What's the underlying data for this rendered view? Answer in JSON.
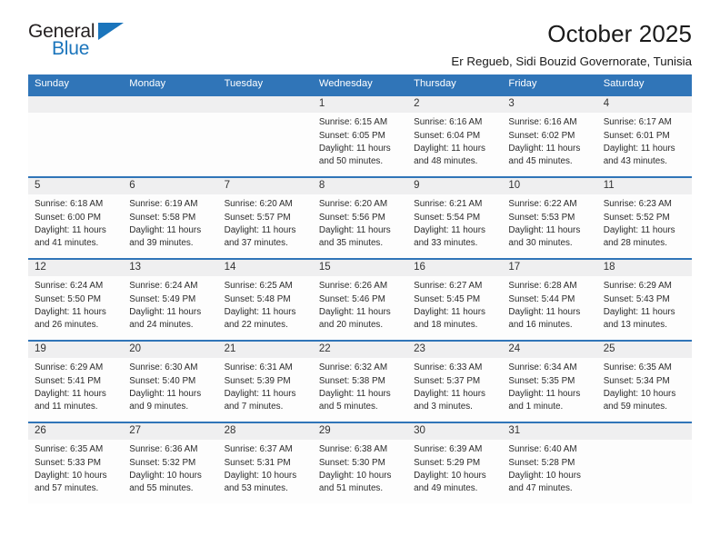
{
  "brand": {
    "name_part1": "General",
    "name_part2": "Blue",
    "accent_color": "#1b75bc",
    "triangle_icon": "triangle-icon"
  },
  "header": {
    "title": "October 2025",
    "subtitle": "Er Regueb, Sidi Bouzid Governorate, Tunisia"
  },
  "calendar": {
    "header_color": "#3075b8",
    "date_band_color": "#efeff0",
    "weekdays": [
      "Sunday",
      "Monday",
      "Tuesday",
      "Wednesday",
      "Thursday",
      "Friday",
      "Saturday"
    ],
    "weeks": [
      [
        {
          "day": "",
          "sunrise": "",
          "sunset": "",
          "daylight_line1": "",
          "daylight_line2": ""
        },
        {
          "day": "",
          "sunrise": "",
          "sunset": "",
          "daylight_line1": "",
          "daylight_line2": ""
        },
        {
          "day": "",
          "sunrise": "",
          "sunset": "",
          "daylight_line1": "",
          "daylight_line2": ""
        },
        {
          "day": "1",
          "sunrise": "Sunrise: 6:15 AM",
          "sunset": "Sunset: 6:05 PM",
          "daylight_line1": "Daylight: 11 hours",
          "daylight_line2": "and 50 minutes."
        },
        {
          "day": "2",
          "sunrise": "Sunrise: 6:16 AM",
          "sunset": "Sunset: 6:04 PM",
          "daylight_line1": "Daylight: 11 hours",
          "daylight_line2": "and 48 minutes."
        },
        {
          "day": "3",
          "sunrise": "Sunrise: 6:16 AM",
          "sunset": "Sunset: 6:02 PM",
          "daylight_line1": "Daylight: 11 hours",
          "daylight_line2": "and 45 minutes."
        },
        {
          "day": "4",
          "sunrise": "Sunrise: 6:17 AM",
          "sunset": "Sunset: 6:01 PM",
          "daylight_line1": "Daylight: 11 hours",
          "daylight_line2": "and 43 minutes."
        }
      ],
      [
        {
          "day": "5",
          "sunrise": "Sunrise: 6:18 AM",
          "sunset": "Sunset: 6:00 PM",
          "daylight_line1": "Daylight: 11 hours",
          "daylight_line2": "and 41 minutes."
        },
        {
          "day": "6",
          "sunrise": "Sunrise: 6:19 AM",
          "sunset": "Sunset: 5:58 PM",
          "daylight_line1": "Daylight: 11 hours",
          "daylight_line2": "and 39 minutes."
        },
        {
          "day": "7",
          "sunrise": "Sunrise: 6:20 AM",
          "sunset": "Sunset: 5:57 PM",
          "daylight_line1": "Daylight: 11 hours",
          "daylight_line2": "and 37 minutes."
        },
        {
          "day": "8",
          "sunrise": "Sunrise: 6:20 AM",
          "sunset": "Sunset: 5:56 PM",
          "daylight_line1": "Daylight: 11 hours",
          "daylight_line2": "and 35 minutes."
        },
        {
          "day": "9",
          "sunrise": "Sunrise: 6:21 AM",
          "sunset": "Sunset: 5:54 PM",
          "daylight_line1": "Daylight: 11 hours",
          "daylight_line2": "and 33 minutes."
        },
        {
          "day": "10",
          "sunrise": "Sunrise: 6:22 AM",
          "sunset": "Sunset: 5:53 PM",
          "daylight_line1": "Daylight: 11 hours",
          "daylight_line2": "and 30 minutes."
        },
        {
          "day": "11",
          "sunrise": "Sunrise: 6:23 AM",
          "sunset": "Sunset: 5:52 PM",
          "daylight_line1": "Daylight: 11 hours",
          "daylight_line2": "and 28 minutes."
        }
      ],
      [
        {
          "day": "12",
          "sunrise": "Sunrise: 6:24 AM",
          "sunset": "Sunset: 5:50 PM",
          "daylight_line1": "Daylight: 11 hours",
          "daylight_line2": "and 26 minutes."
        },
        {
          "day": "13",
          "sunrise": "Sunrise: 6:24 AM",
          "sunset": "Sunset: 5:49 PM",
          "daylight_line1": "Daylight: 11 hours",
          "daylight_line2": "and 24 minutes."
        },
        {
          "day": "14",
          "sunrise": "Sunrise: 6:25 AM",
          "sunset": "Sunset: 5:48 PM",
          "daylight_line1": "Daylight: 11 hours",
          "daylight_line2": "and 22 minutes."
        },
        {
          "day": "15",
          "sunrise": "Sunrise: 6:26 AM",
          "sunset": "Sunset: 5:46 PM",
          "daylight_line1": "Daylight: 11 hours",
          "daylight_line2": "and 20 minutes."
        },
        {
          "day": "16",
          "sunrise": "Sunrise: 6:27 AM",
          "sunset": "Sunset: 5:45 PM",
          "daylight_line1": "Daylight: 11 hours",
          "daylight_line2": "and 18 minutes."
        },
        {
          "day": "17",
          "sunrise": "Sunrise: 6:28 AM",
          "sunset": "Sunset: 5:44 PM",
          "daylight_line1": "Daylight: 11 hours",
          "daylight_line2": "and 16 minutes."
        },
        {
          "day": "18",
          "sunrise": "Sunrise: 6:29 AM",
          "sunset": "Sunset: 5:43 PM",
          "daylight_line1": "Daylight: 11 hours",
          "daylight_line2": "and 13 minutes."
        }
      ],
      [
        {
          "day": "19",
          "sunrise": "Sunrise: 6:29 AM",
          "sunset": "Sunset: 5:41 PM",
          "daylight_line1": "Daylight: 11 hours",
          "daylight_line2": "and 11 minutes."
        },
        {
          "day": "20",
          "sunrise": "Sunrise: 6:30 AM",
          "sunset": "Sunset: 5:40 PM",
          "daylight_line1": "Daylight: 11 hours",
          "daylight_line2": "and 9 minutes."
        },
        {
          "day": "21",
          "sunrise": "Sunrise: 6:31 AM",
          "sunset": "Sunset: 5:39 PM",
          "daylight_line1": "Daylight: 11 hours",
          "daylight_line2": "and 7 minutes."
        },
        {
          "day": "22",
          "sunrise": "Sunrise: 6:32 AM",
          "sunset": "Sunset: 5:38 PM",
          "daylight_line1": "Daylight: 11 hours",
          "daylight_line2": "and 5 minutes."
        },
        {
          "day": "23",
          "sunrise": "Sunrise: 6:33 AM",
          "sunset": "Sunset: 5:37 PM",
          "daylight_line1": "Daylight: 11 hours",
          "daylight_line2": "and 3 minutes."
        },
        {
          "day": "24",
          "sunrise": "Sunrise: 6:34 AM",
          "sunset": "Sunset: 5:35 PM",
          "daylight_line1": "Daylight: 11 hours",
          "daylight_line2": "and 1 minute."
        },
        {
          "day": "25",
          "sunrise": "Sunrise: 6:35 AM",
          "sunset": "Sunset: 5:34 PM",
          "daylight_line1": "Daylight: 10 hours",
          "daylight_line2": "and 59 minutes."
        }
      ],
      [
        {
          "day": "26",
          "sunrise": "Sunrise: 6:35 AM",
          "sunset": "Sunset: 5:33 PM",
          "daylight_line1": "Daylight: 10 hours",
          "daylight_line2": "and 57 minutes."
        },
        {
          "day": "27",
          "sunrise": "Sunrise: 6:36 AM",
          "sunset": "Sunset: 5:32 PM",
          "daylight_line1": "Daylight: 10 hours",
          "daylight_line2": "and 55 minutes."
        },
        {
          "day": "28",
          "sunrise": "Sunrise: 6:37 AM",
          "sunset": "Sunset: 5:31 PM",
          "daylight_line1": "Daylight: 10 hours",
          "daylight_line2": "and 53 minutes."
        },
        {
          "day": "29",
          "sunrise": "Sunrise: 6:38 AM",
          "sunset": "Sunset: 5:30 PM",
          "daylight_line1": "Daylight: 10 hours",
          "daylight_line2": "and 51 minutes."
        },
        {
          "day": "30",
          "sunrise": "Sunrise: 6:39 AM",
          "sunset": "Sunset: 5:29 PM",
          "daylight_line1": "Daylight: 10 hours",
          "daylight_line2": "and 49 minutes."
        },
        {
          "day": "31",
          "sunrise": "Sunrise: 6:40 AM",
          "sunset": "Sunset: 5:28 PM",
          "daylight_line1": "Daylight: 10 hours",
          "daylight_line2": "and 47 minutes."
        },
        {
          "day": "",
          "sunrise": "",
          "sunset": "",
          "daylight_line1": "",
          "daylight_line2": ""
        }
      ]
    ]
  }
}
